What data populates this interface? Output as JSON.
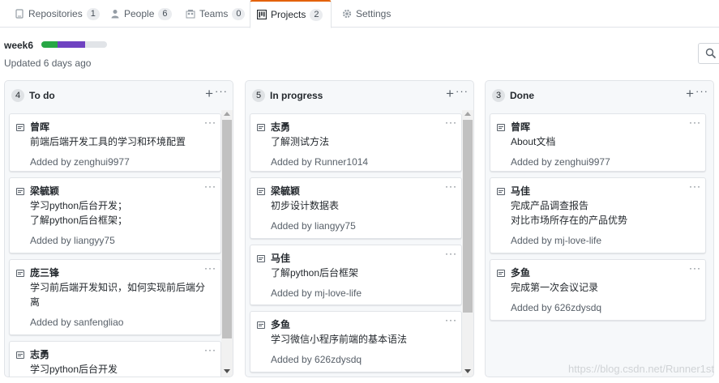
{
  "tabs": [
    {
      "label": "Repositories",
      "count": "1",
      "icon": "repo-icon"
    },
    {
      "label": "People",
      "count": "6",
      "icon": "person-icon"
    },
    {
      "label": "Teams",
      "count": "0",
      "icon": "team-icon"
    },
    {
      "label": "Projects",
      "count": "2",
      "icon": "project-icon",
      "selected": true
    },
    {
      "label": "Settings",
      "count": "",
      "icon": "gear-icon"
    }
  ],
  "project": {
    "name": "week6",
    "updated": "Updated 6 days ago",
    "progress": {
      "done_pct": 25,
      "in_progress_pct": 42,
      "done_color": "#28a745",
      "in_progress_color": "#6f42c1",
      "todo_color": "#e1e4e8"
    }
  },
  "columns": [
    {
      "count": "4",
      "name": "To do",
      "cards": [
        {
          "title": "曾晖",
          "lines": [
            "前端后端开发工具的学习和环境配置"
          ],
          "added": "Added by zenghui9977"
        },
        {
          "title": "梁毓颖",
          "lines": [
            "学习python后台开发；",
            "了解python后台框架；"
          ],
          "added": "Added by liangyy75"
        },
        {
          "title": "庞三锋",
          "lines": [
            "学习前后端开发知识，如何实现前后端分",
            "离"
          ],
          "added": "Added by sanfengliao"
        },
        {
          "title": "志勇",
          "lines": [
            "学习python后台开发"
          ],
          "added": ""
        }
      ]
    },
    {
      "count": "5",
      "name": "In progress",
      "cards": [
        {
          "title": "志勇",
          "lines": [
            "了解测试方法"
          ],
          "added": "Added by Runner1014"
        },
        {
          "title": "梁毓颖",
          "lines": [
            "初步设计数据表"
          ],
          "added": "Added by liangyy75"
        },
        {
          "title": "马佳",
          "lines": [
            "了解python后台框架"
          ],
          "added": "Added by mj-love-life"
        },
        {
          "title": "多鱼",
          "lines": [
            "学习微信小程序前端的基本语法"
          ],
          "added": "Added by 626zdysdq"
        }
      ]
    },
    {
      "count": "3",
      "name": "Done",
      "cards": [
        {
          "title": "曾晖",
          "lines": [
            "About文档"
          ],
          "added": "Added by zenghui9977"
        },
        {
          "title": "马佳",
          "lines": [
            "完成产品调查报告",
            "对比市场所存在的产品优势"
          ],
          "added": "Added by mj-love-life"
        },
        {
          "title": "多鱼",
          "lines": [
            "完成第一次会议记录"
          ],
          "added": "Added by 626zdysdq"
        }
      ]
    }
  ],
  "watermark": "https://blog.csdn.net/Runner1st"
}
